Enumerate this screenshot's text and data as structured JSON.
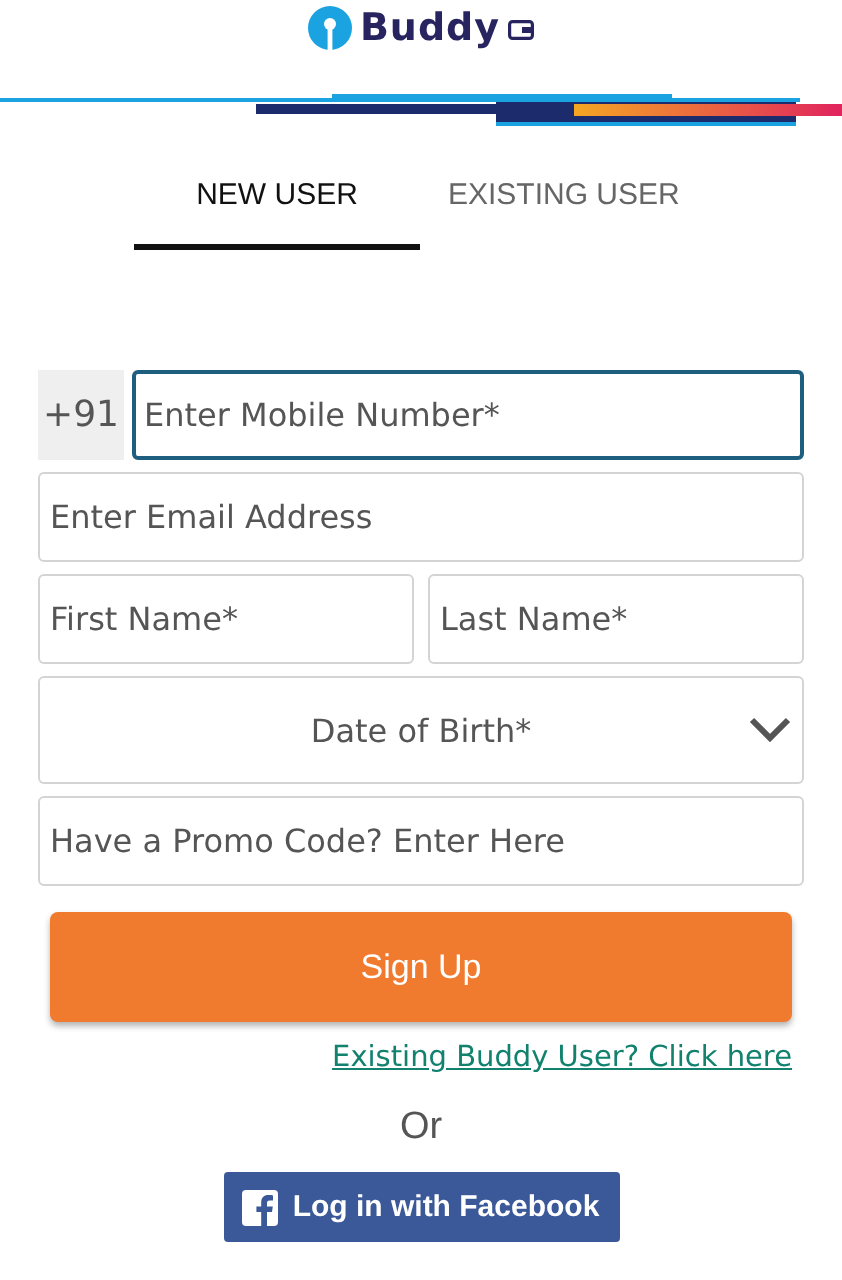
{
  "header": {
    "logo_text": "Buddy"
  },
  "tabs": [
    {
      "label": "NEW USER",
      "selected": true
    },
    {
      "label": "EXISTING USER",
      "selected": false
    }
  ],
  "form": {
    "country_code": "+91",
    "rows": [
      {
        "fields": [
          {
            "kind": "phone",
            "placeholder": "Enter Mobile Number*",
            "focused": true
          }
        ]
      },
      {
        "fields": [
          {
            "kind": "text",
            "placeholder": "Enter Email Address",
            "focused": false
          }
        ]
      },
      {
        "fields": [
          {
            "kind": "text",
            "placeholder": "First Name*",
            "focused": false
          },
          {
            "kind": "text",
            "placeholder": "Last Name*",
            "focused": false
          }
        ]
      },
      {
        "fields": [
          {
            "kind": "select",
            "placeholder": "Date of Birth*",
            "focused": false
          }
        ]
      },
      {
        "fields": [
          {
            "kind": "text",
            "placeholder": "Have a Promo Code? Enter Here",
            "focused": false
          }
        ]
      }
    ],
    "submit": "Sign Up",
    "existing_link": "Existing Buddy User? Click here",
    "separator": "Or",
    "facebook_button": "Log in with Facebook"
  }
}
